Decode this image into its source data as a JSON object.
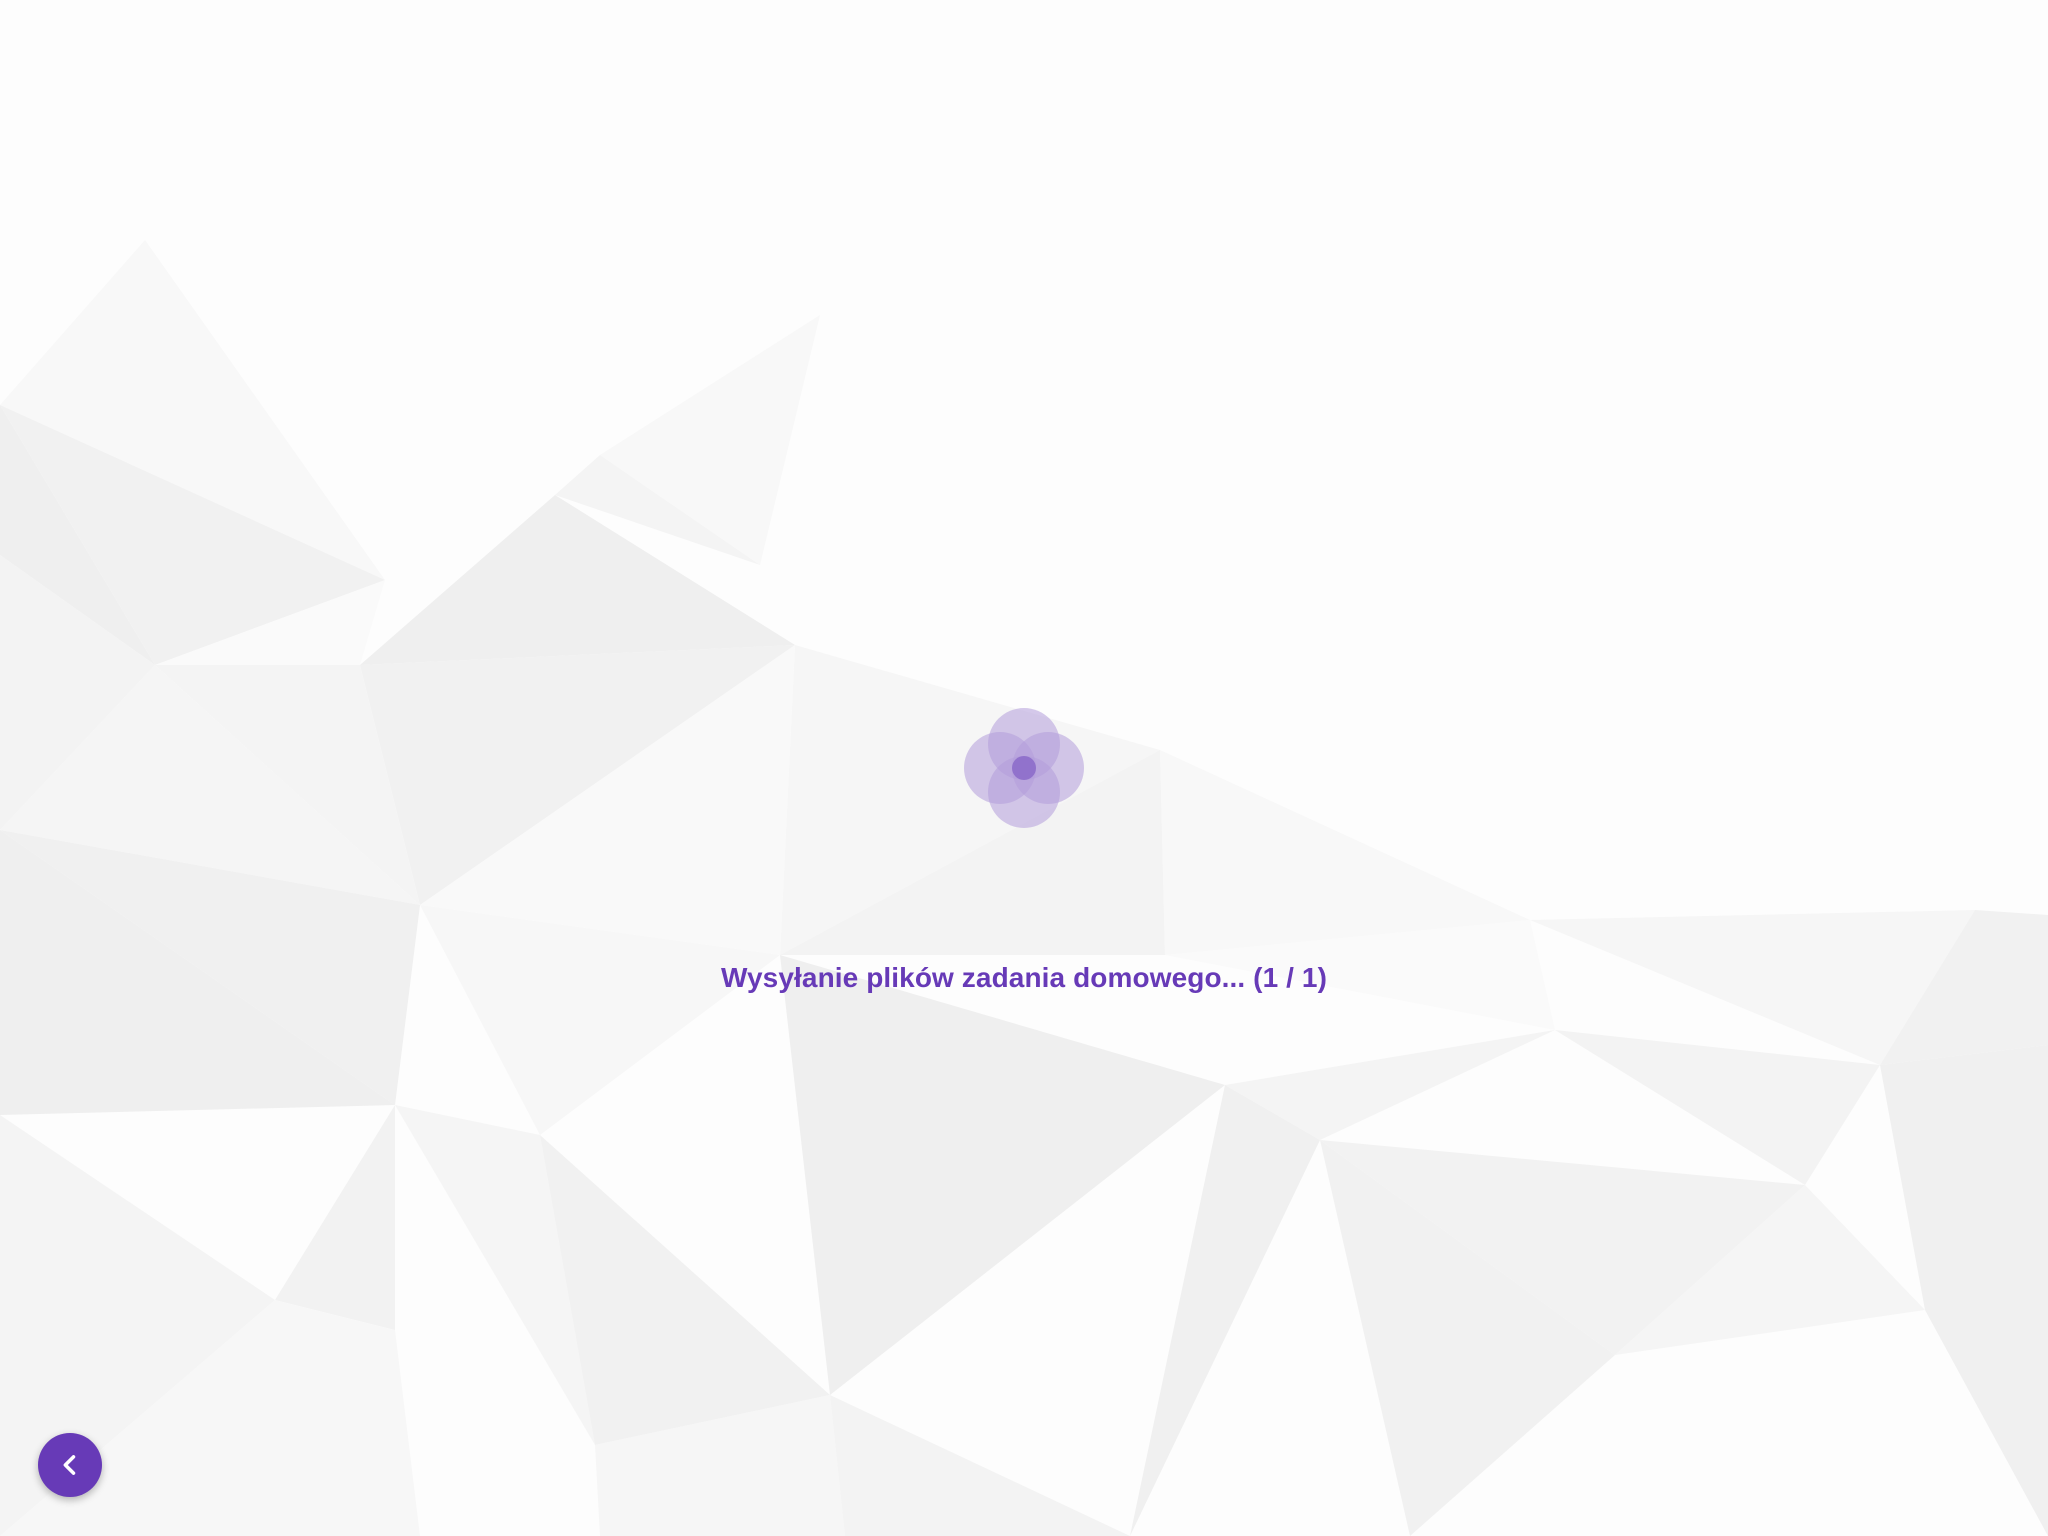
{
  "colors": {
    "accent": "#673ab7",
    "loader_circle": "#b39ddb",
    "background": "#fdfdfd"
  },
  "upload": {
    "status_text": "Wysyłanie plików zadania domowego... (1 / 1)",
    "current": 1,
    "total": 1
  },
  "back_button": {
    "icon": "chevron-left-icon"
  }
}
